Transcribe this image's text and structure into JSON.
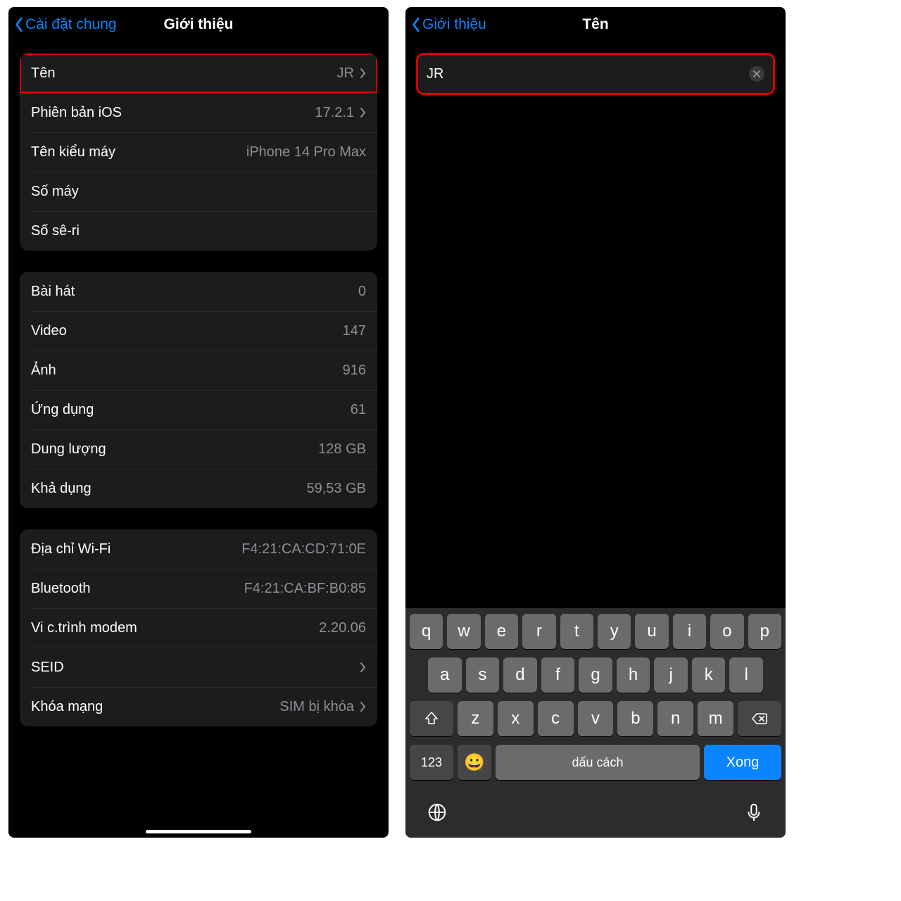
{
  "left": {
    "back": "Cài đặt chung",
    "title": "Giới thiệu",
    "s1": {
      "name_label": "Tên",
      "name_value": "JR",
      "ios_label": "Phiên bản iOS",
      "ios_value": "17.2.1",
      "model_label": "Tên kiểu máy",
      "model_value": "iPhone 14 Pro Max",
      "modelnum_label": "Số máy",
      "serial_label": "Số sê-ri"
    },
    "s2": {
      "songs_label": "Bài hát",
      "songs_value": "0",
      "videos_label": "Video",
      "videos_value": "147",
      "photos_label": "Ảnh",
      "photos_value": "916",
      "apps_label": "Ứng dụng",
      "apps_value": "61",
      "capacity_label": "Dung lượng",
      "capacity_value": "128 GB",
      "avail_label": "Khả dụng",
      "avail_value": "59,53 GB"
    },
    "s3": {
      "wifi_label": "Địa chỉ Wi-Fi",
      "wifi_value": "F4:21:CA:CD:71:0E",
      "bt_label": "Bluetooth",
      "bt_value": "F4:21:CA:BF:B0:85",
      "modem_label": "Vi c.trình modem",
      "modem_value": "2.20.06",
      "seid_label": "SEID",
      "carrier_label": "Khóa mạng",
      "carrier_value": "SIM bị khóa"
    }
  },
  "right": {
    "back": "Giới thiệu",
    "title": "Tên",
    "name_value": "JR",
    "keyboard": {
      "r1": [
        "q",
        "w",
        "e",
        "r",
        "t",
        "y",
        "u",
        "i",
        "o",
        "p"
      ],
      "r2": [
        "a",
        "s",
        "d",
        "f",
        "g",
        "h",
        "j",
        "k",
        "l"
      ],
      "r3": [
        "z",
        "x",
        "c",
        "v",
        "b",
        "n",
        "m"
      ],
      "num": "123",
      "space": "dấu cách",
      "done": "Xong"
    }
  }
}
